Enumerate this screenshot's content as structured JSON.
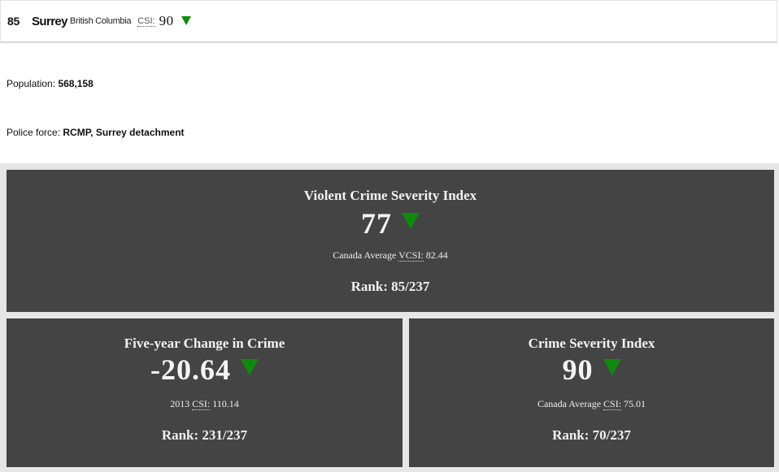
{
  "header": {
    "rank": "85",
    "city": "Surrey",
    "province": "British Columbia",
    "csi_label": "CSI:",
    "csi_value": "90",
    "trend_icon": "triangle-down-icon",
    "trend_color": "#0f8a0f"
  },
  "info": {
    "population_label": "Population:",
    "population_value": "568,158",
    "police_label": "Police force:",
    "police_value": "RCMP, Surrey detachment"
  },
  "panels": {
    "violent": {
      "title": "Violent Crime Severity Index",
      "value": "77",
      "avg_prefix": "Canada Average",
      "avg_abbr": "VCSI:",
      "avg_value": "82.44",
      "rank_text": "Rank: 85/237"
    },
    "five_year": {
      "title": "Five-year Change in Crime",
      "value": "-20.64",
      "avg_prefix": "2013",
      "avg_abbr": "CSI:",
      "avg_value": "110.14",
      "rank_text": "Rank: 231/237"
    },
    "csi": {
      "title": "Crime Severity Index",
      "value": "90",
      "avg_prefix": "Canada Average",
      "avg_abbr": "CSI:",
      "avg_value": "75.01",
      "rank_text": "Rank: 70/237"
    }
  },
  "colors": {
    "panel_bg": "#444444",
    "trend_green": "#0f8a0f"
  }
}
